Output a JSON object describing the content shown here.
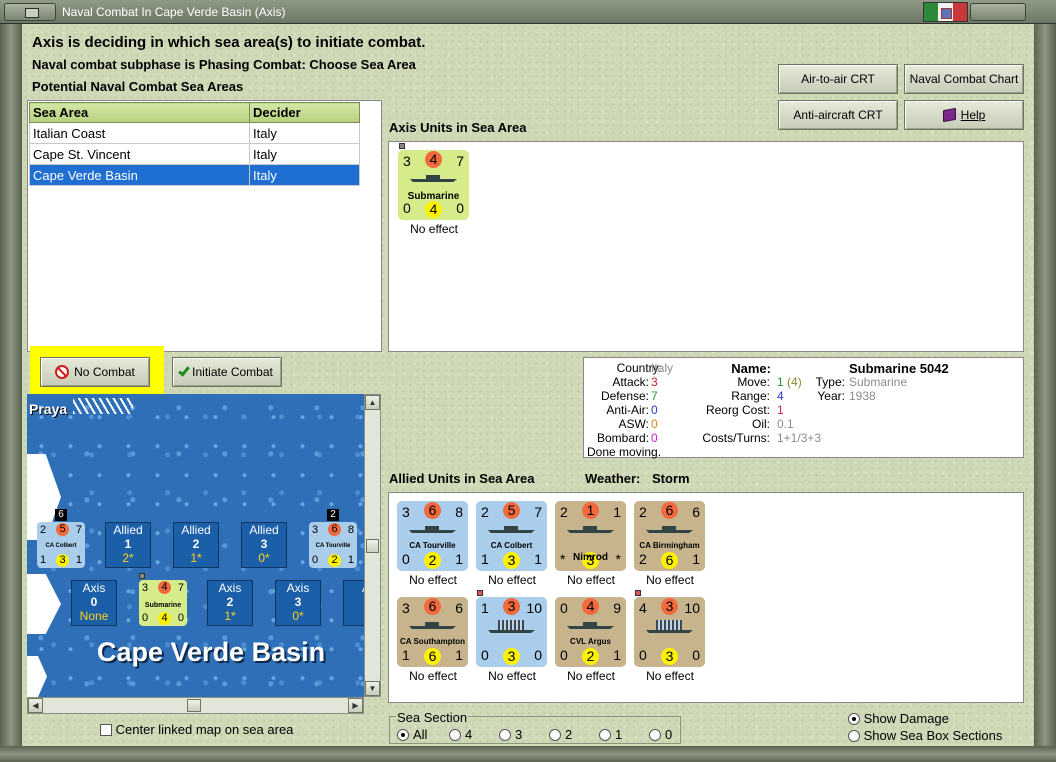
{
  "window": {
    "title": "Naval Combat In Cape Verde Basin (Axis)"
  },
  "header": {
    "line1": "Axis is deciding in which sea area(s) to initiate combat.",
    "line2": "Naval combat subphase is Phasing Combat: Choose Sea Area",
    "line3": "Potential Naval Combat Sea Areas"
  },
  "buttons": {
    "air_to_air": "Air-to-air CRT",
    "naval_chart": "Naval Combat Chart",
    "anti_aircraft": "Anti-aircraft CRT",
    "help": "Help",
    "no_combat": "No Combat",
    "initiate": "Initiate Combat"
  },
  "sea_table": {
    "headers": [
      "Sea Area",
      "Decider"
    ],
    "rows": [
      [
        "Italian Coast",
        "Italy"
      ],
      [
        "Cape St. Vincent",
        "Italy"
      ],
      [
        "Cape Verde Basin",
        "Italy"
      ]
    ],
    "selected_index": 2
  },
  "axis_section": {
    "title": "Axis Units in Sea Area",
    "units": [
      {
        "name": "Submarine",
        "tl": "3",
        "tm": "4",
        "tr": "7",
        "bl": "0",
        "bm": "4",
        "br": "0",
        "effect": "No effect"
      }
    ]
  },
  "info": {
    "country_label": "Country:",
    "country": "Italy",
    "attack_label": "Attack:",
    "attack": "3",
    "defense_label": "Defense:",
    "defense": "7",
    "antiair_label": "Anti-Air:",
    "antiair": "0",
    "asw_label": "ASW:",
    "asw": "0",
    "bombard_label": "Bombard:",
    "bombard": "0",
    "status": "Done moving.",
    "name_label": "Name:",
    "name": "Submarine 5042",
    "move_label": "Move:",
    "move": "1",
    "move_extra": "(4)",
    "type_label": "Type:",
    "type": "Submarine",
    "range_label": "Range:",
    "range": "4",
    "year_label": "Year:",
    "year": "1938",
    "reorg_label": "Reorg Cost:",
    "reorg": "1",
    "oil_label": "Oil:",
    "oil": "0.1",
    "costs_label": "Costs/Turns:",
    "costs": "1+1/3+3"
  },
  "allied_section": {
    "title": "Allied Units in Sea Area",
    "weather_label": "Weather:",
    "weather": "Storm",
    "units": [
      {
        "name": "CA Tourville",
        "color": "blue",
        "tl": "3",
        "tm": "6",
        "tr": "8",
        "bl": "0",
        "bm": "2",
        "br": "1",
        "effect": "No effect"
      },
      {
        "name": "CA Colbert",
        "color": "blue",
        "tl": "2",
        "tm": "5",
        "tr": "7",
        "bl": "1",
        "bm": "3",
        "br": "1",
        "effect": "No effect"
      },
      {
        "name": "Nimrod",
        "color": "tan",
        "tl": "2",
        "tm": "1",
        "tr": "1",
        "bl": "*",
        "bm": "3",
        "br": "*",
        "effect": "No effect"
      },
      {
        "name": "CA Birmingham",
        "color": "tan",
        "tl": "2",
        "tm": "6",
        "tr": "6",
        "bl": "2",
        "bm": "6",
        "br": "1",
        "effect": "No effect"
      },
      {
        "name": "CA Southampton",
        "color": "tan",
        "tl": "3",
        "tm": "6",
        "tr": "6",
        "bl": "1",
        "bm": "6",
        "br": "1",
        "effect": "No effect"
      },
      {
        "name": "",
        "color": "blue",
        "tl": "1",
        "tm": "3",
        "tr": "10",
        "bl": "0",
        "bm": "3",
        "br": "0",
        "effect": "No effect"
      },
      {
        "name": "CVL Argus",
        "color": "tan",
        "tl": "0",
        "tm": "4",
        "tr": "9",
        "bl": "0",
        "bm": "2",
        "br": "1",
        "effect": "No effect"
      },
      {
        "name": "",
        "color": "tan",
        "tl": "4",
        "tm": "3",
        "tr": "10",
        "bl": "0",
        "bm": "3",
        "br": "0",
        "effect": "No effect"
      }
    ]
  },
  "map": {
    "port_label": "Praya",
    "sea_label": "Cape Verde Basin",
    "allied_boxes": [
      {
        "side": "Allied",
        "num": "1",
        "sub": "2*"
      },
      {
        "side": "Allied",
        "num": "2",
        "sub": "1*"
      },
      {
        "side": "Allied",
        "num": "3",
        "sub": "0*"
      }
    ],
    "axis_boxes": [
      {
        "side": "Axis",
        "num": "0",
        "sub": "None"
      },
      {
        "side": "Axis",
        "num": "2",
        "sub": "1*"
      },
      {
        "side": "Axis",
        "num": "3",
        "sub": "0*"
      },
      {
        "side": "A"
      }
    ],
    "stack_colbert": {
      "count": "6",
      "name": "CA Colbert",
      "tl": "2",
      "tm": "5",
      "tr": "7",
      "bl": "1",
      "bm": "3",
      "br": "1"
    },
    "stack_tourville": {
      "count": "2",
      "name": "CA Tourville",
      "tl": "3",
      "tm": "6",
      "tr": "8",
      "bl": "0",
      "bm": "2",
      "br": "1"
    },
    "sub_counter": {
      "name": "Submarine",
      "tl": "3",
      "tm": "4",
      "tr": "7",
      "bl": "0",
      "bm": "4",
      "br": "0"
    }
  },
  "bottom": {
    "center_map": "Center linked map on sea area",
    "sea_section_label": "Sea Section",
    "sea_section_options": [
      "All",
      "4",
      "3",
      "2",
      "1",
      "0"
    ],
    "show_damage": "Show Damage",
    "show_sea_box": "Show Sea Box Sections"
  },
  "colors": {
    "selected_row": "#1e6fd1",
    "highlight": "#ffff00",
    "panel_bg": "#cfd9b8"
  }
}
